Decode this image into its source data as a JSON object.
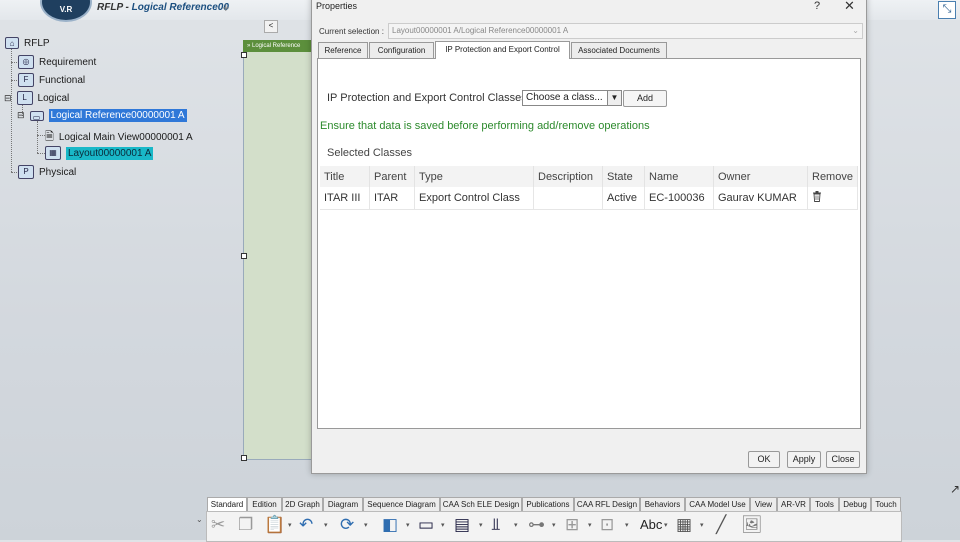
{
  "app": {
    "logo_text": "V.R",
    "title_prefix": "RFLP - ",
    "title_main": "Logical Reference00",
    "new_tab": "+",
    "collapse_icon": "collapse-arrow-icon"
  },
  "tree": {
    "root": "RFLP",
    "requirement": "Requirement",
    "functional": "Functional",
    "logical": "Logical",
    "logical_ref": "Logical Reference00000001 A",
    "main_view": "Logical Main View00000001 A",
    "layout": "Layout00000001 A",
    "physical": "Physical",
    "scroll_arrow": "<"
  },
  "canvas": {
    "header": "» Logical Reference"
  },
  "dialog": {
    "title": "Properties",
    "help": "?",
    "close": "✕",
    "current_selection_label": "Current selection :",
    "current_selection_value": "Layout00000001 A/Logical Reference00000001 A",
    "tabs": [
      {
        "label": "Reference"
      },
      {
        "label": "Configuration"
      },
      {
        "label": "IP Protection and Export Control"
      },
      {
        "label": "Associated Documents"
      }
    ],
    "ip_label": "IP Protection and Export Control Classes",
    "class_select": "Choose a class...",
    "add_label": "Add",
    "warning": "Ensure that data is saved before performing add/remove operations",
    "selected_classes_label": "Selected Classes",
    "columns": [
      "Title",
      "Parent",
      "Type",
      "Description",
      "State",
      "Name",
      "Owner",
      "Remove"
    ],
    "rows": [
      {
        "title": "ITAR III",
        "parent": "ITAR",
        "type": "Export Control Class",
        "description": "",
        "state": "Active",
        "name": "EC-100036",
        "owner": "Gaurav KUMAR",
        "remove_icon": "trash-icon"
      }
    ],
    "ok": "OK",
    "apply": "Apply",
    "close_btn": "Close"
  },
  "toolbar": {
    "tabs": [
      "Standard",
      "Edition",
      "2D Graph",
      "Diagram",
      "Sequence Diagram",
      "CAA Sch ELE Design",
      "Publications",
      "CAA RFL Design",
      "Behaviors",
      "CAA Model Use",
      "View",
      "AR-VR",
      "Tools",
      "Debug",
      "Touch"
    ],
    "active_tab": "Standard",
    "text_tool": "Abc"
  },
  "colors": {
    "selection": "#2f78d8",
    "selection_alt": "#19b8c8",
    "warning_text": "#2c8a2c",
    "canvas_header": "#5c8f3c"
  }
}
